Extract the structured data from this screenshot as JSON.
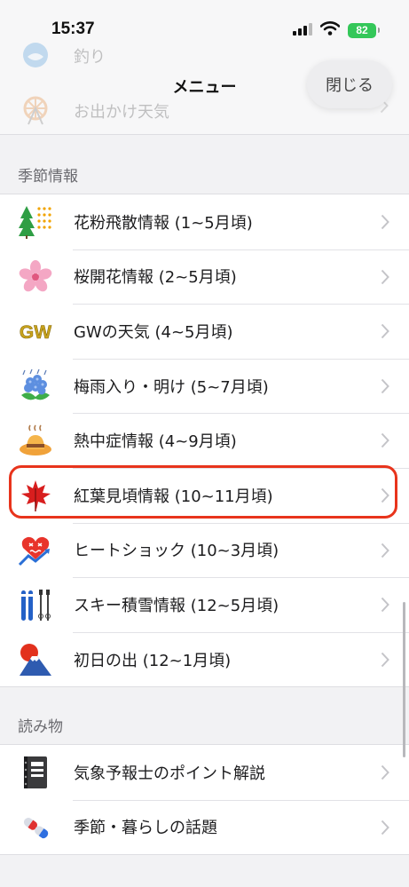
{
  "status_bar": {
    "time": "15:37",
    "battery": "82"
  },
  "header": {
    "title": "メニュー",
    "close_label": "閉じる"
  },
  "background_items": [
    {
      "label": "釣り",
      "icon": "fishing-icon"
    },
    {
      "label": "お出かけ天気",
      "icon": "ferris-wheel-icon"
    }
  ],
  "sections": {
    "seasonal": {
      "title": "季節情報",
      "items": [
        {
          "label": "花粉飛散情報 (1~5月頃)",
          "icon": "pollen-tree-icon"
        },
        {
          "label": "桜開花情報 (2~5月頃)",
          "icon": "cherry-blossom-icon"
        },
        {
          "label": "GWの天気 (4~5月頃)",
          "icon": "gw-icon",
          "icon_text": "GW"
        },
        {
          "label": "梅雨入り・明け (5~7月頃)",
          "icon": "hydrangea-icon"
        },
        {
          "label": "熱中症情報 (4~9月頃)",
          "icon": "hot-hat-icon"
        },
        {
          "label": "紅葉見頃情報 (10~11月頃)",
          "icon": "maple-leaf-icon"
        },
        {
          "label": "ヒートショック (10~3月頃)",
          "icon": "heart-shock-icon"
        },
        {
          "label": "スキー積雪情報 (12~5月頃)",
          "icon": "ski-icon"
        },
        {
          "label": "初日の出 (12~1月頃)",
          "icon": "sunrise-fuji-icon"
        }
      ]
    },
    "reading": {
      "title": "読み物",
      "items": [
        {
          "label": "気象予報士のポイント解説",
          "icon": "notebook-icon"
        },
        {
          "label": "季節・暮らしの話題",
          "icon": "pills-icon"
        }
      ]
    }
  },
  "colors": {
    "highlight": "#e8341c",
    "battery": "#34c759",
    "chevron": "#c4c4c8"
  }
}
